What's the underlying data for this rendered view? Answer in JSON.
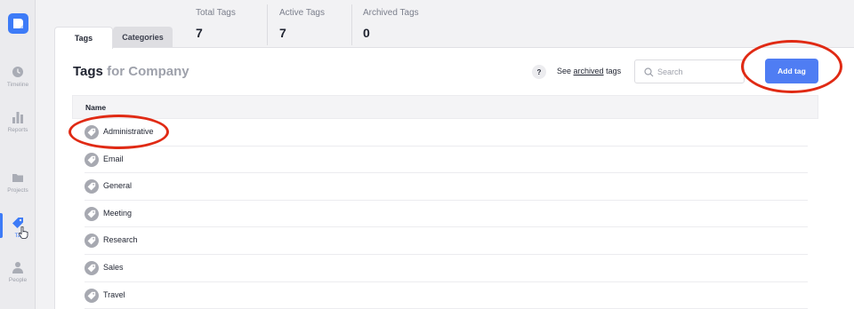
{
  "sidebar": {
    "items": [
      {
        "label": "Timeline",
        "icon": "clock-icon"
      },
      {
        "label": "Reports",
        "icon": "bar-chart-icon"
      },
      {
        "label": "Projects",
        "icon": "folder-icon"
      },
      {
        "label": "Tags",
        "icon": "tag-icon",
        "active": true,
        "visible_label": "Ta"
      },
      {
        "label": "People",
        "icon": "person-icon"
      }
    ]
  },
  "stats": [
    {
      "label": "Total Tags",
      "value": "7"
    },
    {
      "label": "Active Tags",
      "value": "7"
    },
    {
      "label": "Archived Tags",
      "value": "0"
    }
  ],
  "tabs": [
    {
      "label": "Tags",
      "active": true
    },
    {
      "label": "Categories",
      "active": false
    }
  ],
  "header": {
    "title": "Tags",
    "subtitle": "for Company",
    "help_label": "?",
    "archived_prefix": "See",
    "archived_link": "archived",
    "archived_suffix": "tags",
    "search_placeholder": "Search",
    "add_label": "Add tag"
  },
  "table": {
    "column_name": "Name",
    "rows": [
      "Administrative",
      "Email",
      "General",
      "Meeting",
      "Research",
      "Sales",
      "Travel"
    ]
  },
  "colors": {
    "accent": "#4f7df3",
    "annotation": "#e02a14"
  }
}
